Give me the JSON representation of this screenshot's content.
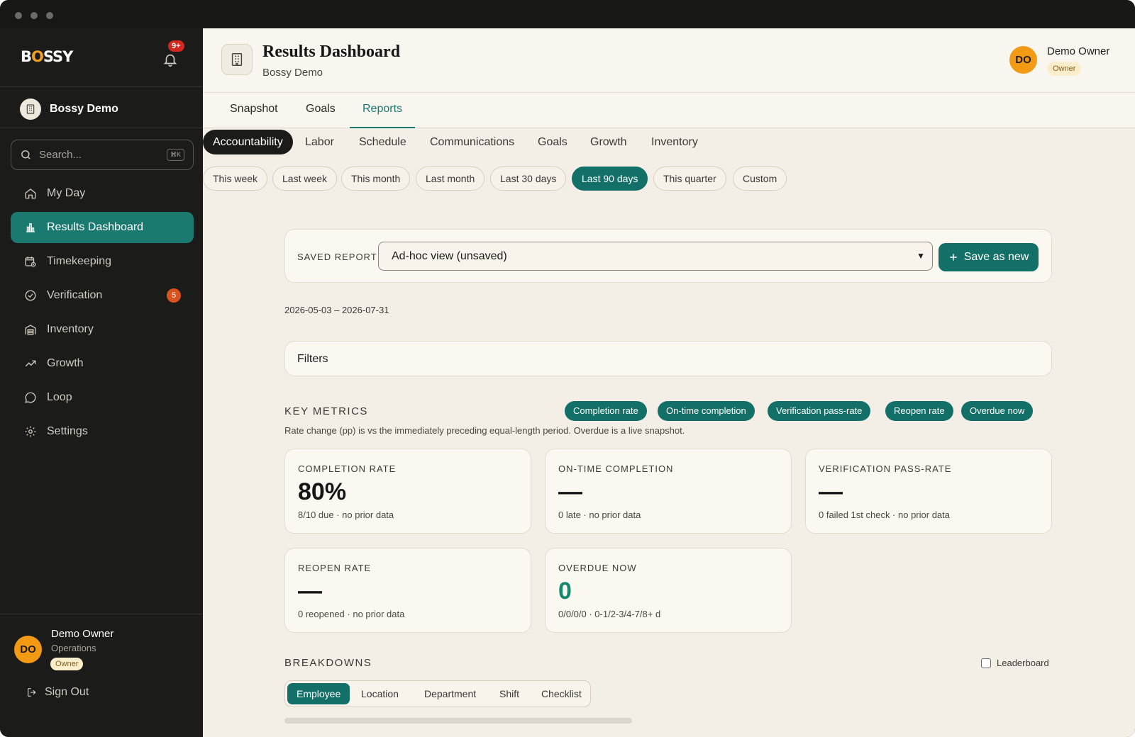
{
  "brand": {
    "name_prefix": "B",
    "name_o": "O",
    "name_suffix": "SSY",
    "notif_badge": "9+"
  },
  "sidebar": {
    "org_name": "Bossy Demo",
    "search_placeholder": "Search...",
    "search_shortcut": "⌘K",
    "items": [
      {
        "label": "My Day",
        "icon": "home-icon"
      },
      {
        "label": "Results Dashboard",
        "icon": "bar-chart-icon",
        "active": true
      },
      {
        "label": "Timekeeping",
        "icon": "calendar-clock-icon"
      },
      {
        "label": "Verification",
        "icon": "check-circle-icon",
        "badge": "5"
      },
      {
        "label": "Inventory",
        "icon": "warehouse-icon"
      },
      {
        "label": "Growth",
        "icon": "trend-up-icon"
      },
      {
        "label": "Loop",
        "icon": "chat-bubble-icon"
      },
      {
        "label": "Settings",
        "icon": "gear-icon"
      }
    ],
    "user": {
      "initials": "DO",
      "name": "Demo Owner",
      "department": "Operations",
      "role": "Owner"
    },
    "signout": "Sign Out"
  },
  "header": {
    "title": "Results Dashboard",
    "subtitle": "Bossy Demo",
    "user": {
      "initials": "DO",
      "name": "Demo Owner",
      "role": "Owner"
    }
  },
  "tabs": [
    "Snapshot",
    "Goals",
    "Reports"
  ],
  "active_tab": "Reports",
  "subtabs": [
    "Accountability",
    "Labor",
    "Schedule",
    "Communications",
    "Goals",
    "Growth",
    "Inventory"
  ],
  "active_subtab": "Accountability",
  "date_pills": [
    "This week",
    "Last week",
    "This month",
    "Last month",
    "Last 30 days",
    "Last 90 days",
    "This quarter",
    "Custom"
  ],
  "active_date_pill": "Last 90 days",
  "saved_report": {
    "label": "SAVED REPORT",
    "value": "Ad-hoc view (unsaved)",
    "save_button": "Save as new"
  },
  "date_range": "2026-05-03 – 2026-07-31",
  "filters_label": "Filters",
  "key_metrics": {
    "title": "KEY METRICS",
    "toggles": [
      "Completion rate",
      "On-time completion",
      "Verification pass-rate",
      "Reopen rate",
      "Overdue now"
    ],
    "note": "Rate change (pp) is vs the immediately preceding equal-length period. Overdue is a live snapshot.",
    "cards": [
      {
        "label": "COMPLETION RATE",
        "value": "80%",
        "sub": "8/10 due · no prior data"
      },
      {
        "label": "ON-TIME COMPLETION",
        "value": "—",
        "sub": "0 late · no prior data"
      },
      {
        "label": "VERIFICATION PASS-RATE",
        "value": "—",
        "sub": "0 failed 1st check · no prior data"
      },
      {
        "label": "REOPEN RATE",
        "value": "—",
        "sub": "0 reopened · no prior data"
      },
      {
        "label": "OVERDUE NOW",
        "value": "0",
        "sub": "0/0/0/0 · 0-1/2-3/4-7/8+ d"
      }
    ]
  },
  "breakdowns": {
    "title": "BREAKDOWNS",
    "leaderboard_label": "Leaderboard",
    "segments": [
      "Employee",
      "Location",
      "Department",
      "Shift",
      "Checklist"
    ],
    "active_segment": "Employee"
  },
  "colors": {
    "accent": "#137068",
    "sidebar_bg": "#1b1b19",
    "main_bg": "#f3efe6",
    "badge_orange": "#d9531e",
    "avatar": "#f39a14"
  }
}
